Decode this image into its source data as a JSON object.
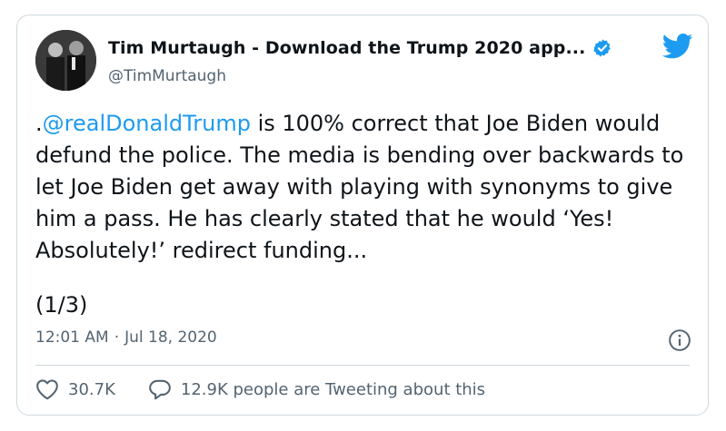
{
  "tweet": {
    "author": {
      "display_name": "Tim Murtaugh - Download the Trump 2020 app...",
      "handle": "@TimMurtaugh",
      "verified_icon": "verified-badge-icon",
      "avatar_icon": "profile-photo"
    },
    "text": {
      "prefix": ".",
      "mention": "@realDonaldTrump",
      "body": " is 100% correct that Joe Biden would defund the police. The media is bending over backwards to let Joe Biden get away with playing with synonyms to give him a pass. He has clearly stated that he would ‘Yes! Absolutely!’ redirect funding..."
    },
    "thread_marker": "(1/3)",
    "time": "12:01 AM",
    "separator": "·",
    "date": "Jul 18, 2020",
    "likes": "30.7K",
    "replies_label": "12.9K people are Tweeting about this"
  },
  "icons": {
    "brand": "twitter-bird-icon",
    "info": "info-icon",
    "like": "heart-icon",
    "reply": "speech-bubble-icon"
  },
  "colors": {
    "link": "#1d9bf0",
    "muted": "#536471",
    "border": "#cfd9de",
    "text": "#0f1419"
  }
}
